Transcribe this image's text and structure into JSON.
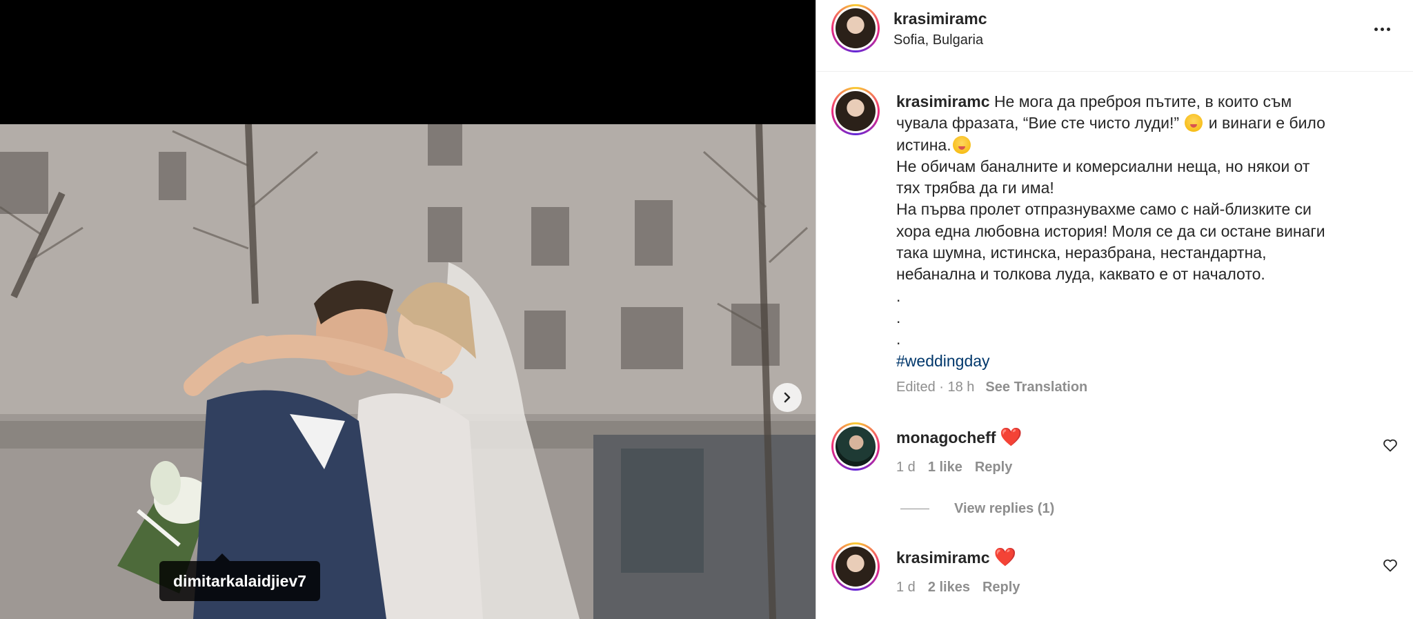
{
  "post": {
    "author": "krasimiramc",
    "location": "Sofia, Bulgaria",
    "photo_tag": "dimitarkalaidjiev7",
    "next_icon": "chevron-right-icon",
    "more_icon": "more-options-icon"
  },
  "caption": {
    "author": "krasimiramc",
    "line1_a": "Не мога да преброя пътите, в които съм",
    "line2_a": "чувала фразата, “Вие сте чисто луди!”",
    "line2_emoji": "shushing-face-emoji",
    "line2_b": "и винаги е било",
    "line3_a": "истина.",
    "line3_emoji": "zany-face-emoji",
    "line4": "Не обичам баналните и комерсиални неща, но някои от",
    "line5": "тях трябва да ги има!",
    "line6": "На първа пролет отпразнувахме само с най-близките си",
    "line7": "хора една любовна история! Моля се да си остане винаги",
    "line8": "така шумна, истинска, неразбрана, нестандартна,",
    "line9": "небанална и толкова луда, каквато е от началото.",
    "dot": ".",
    "hashtag": "#weddingday",
    "edited": "Edited · 18 h",
    "see_translation": "See Translation"
  },
  "comments": [
    {
      "user": "monagocheff",
      "emoji": "❤️",
      "age": "1 d",
      "likes": "1 like",
      "reply": "Reply",
      "view_replies": "View replies (1)"
    },
    {
      "user": "krasimiramc",
      "emoji": "❤️",
      "age": "1 d",
      "likes": "2 likes",
      "reply": "Reply"
    }
  ],
  "colors": {
    "text": "#262626",
    "muted": "#8e8e8e",
    "hashtag": "#00376b",
    "heart": "#e0245e"
  }
}
